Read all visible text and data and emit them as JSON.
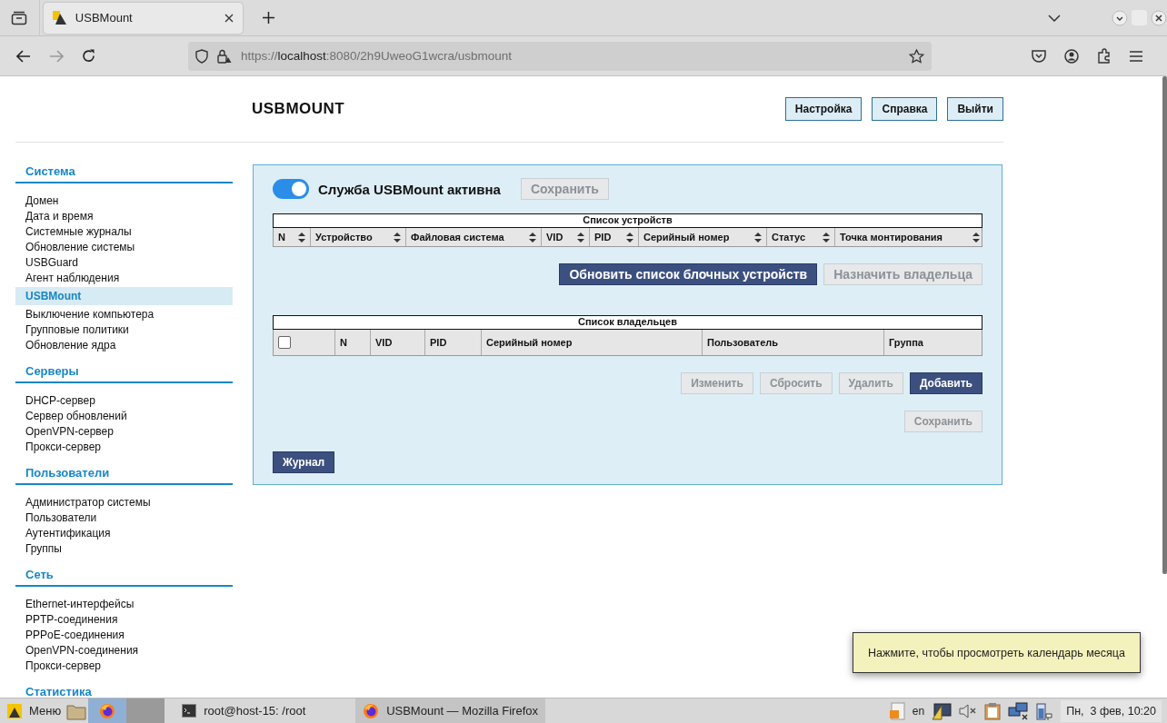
{
  "browser": {
    "tab": {
      "title": "USBMount"
    },
    "url": {
      "scheme": "https://",
      "host": "localhost",
      "rest": ":8080/2h9UweoG1wcra/usbmount"
    }
  },
  "page": {
    "title": "USBMOUNT",
    "header_buttons": [
      "Настройка",
      "Справка",
      "Выйти"
    ],
    "sidebar": [
      {
        "heading": "Система",
        "items": [
          {
            "label": "Домен",
            "selected": false
          },
          {
            "label": "Дата и время",
            "selected": false
          },
          {
            "label": "Системные журналы",
            "selected": false
          },
          {
            "label": "Обновление системы",
            "selected": false
          },
          {
            "label": "USBGuard",
            "selected": false
          },
          {
            "label": "Агент наблюдения",
            "selected": false
          },
          {
            "label": "USBMount",
            "selected": true
          },
          {
            "label": "Выключение компьютера",
            "selected": false
          },
          {
            "label": "Групповые политики",
            "selected": false
          },
          {
            "label": "Обновление ядра",
            "selected": false
          }
        ]
      },
      {
        "heading": "Серверы",
        "items": [
          {
            "label": "DHCP-сервер",
            "selected": false
          },
          {
            "label": "Сервер обновлений",
            "selected": false
          },
          {
            "label": "OpenVPN-сервер",
            "selected": false
          },
          {
            "label": "Прокси-сервер",
            "selected": false
          }
        ]
      },
      {
        "heading": "Пользователи",
        "items": [
          {
            "label": "Администратор системы",
            "selected": false
          },
          {
            "label": "Пользователи",
            "selected": false
          },
          {
            "label": "Аутентификация",
            "selected": false
          },
          {
            "label": "Группы",
            "selected": false
          }
        ]
      },
      {
        "heading": "Сеть",
        "items": [
          {
            "label": "Ethernet-интерфейсы",
            "selected": false
          },
          {
            "label": "PPTP-соединения",
            "selected": false
          },
          {
            "label": "PPPoE-соединения",
            "selected": false
          },
          {
            "label": "OpenVPN-соединения",
            "selected": false
          },
          {
            "label": "Прокси-сервер",
            "selected": false
          }
        ]
      },
      {
        "heading": "Статистика"
      }
    ],
    "service": {
      "on": true,
      "label": "Служба USBMount активна",
      "save_button": {
        "label": "Сохранить",
        "disabled": true
      }
    },
    "devices_table": {
      "caption": "Список устройств",
      "columns": [
        "N",
        "Устройство",
        "Файловая система",
        "VID",
        "PID",
        "Серийный номер",
        "Статус",
        "Точка монтирования"
      ]
    },
    "device_buttons": [
      {
        "label": "Обновить список блочных устройств",
        "disabled": false
      },
      {
        "label": "Назначить владельца",
        "disabled": true
      }
    ],
    "owners_table": {
      "caption": "Список владельцев",
      "select_all_checked": false,
      "columns": [
        "N",
        "VID",
        "PID",
        "Серийный номер",
        "Пользователь",
        "Группа"
      ]
    },
    "owner_buttons": [
      {
        "label": "Изменить",
        "disabled": true
      },
      {
        "label": "Сбросить",
        "disabled": true
      },
      {
        "label": "Удалить",
        "disabled": true
      },
      {
        "label": "Добавить",
        "disabled": false
      }
    ],
    "owners_save_button": {
      "label": "Сохранить",
      "disabled": true
    },
    "journal_button": {
      "label": "Журнал",
      "disabled": false
    }
  },
  "tooltip": "Нажмите, чтобы просмотреть календарь месяца",
  "taskbar": {
    "menu": "Меню",
    "windows": [
      {
        "label": "root@host-15: /root",
        "kind": "terminal",
        "selected": false
      },
      {
        "label": "USBMount — Mozilla Firefox",
        "kind": "browser",
        "selected": true
      }
    ],
    "language": "en",
    "clock": "Пн,  3 фев, 10:20"
  }
}
